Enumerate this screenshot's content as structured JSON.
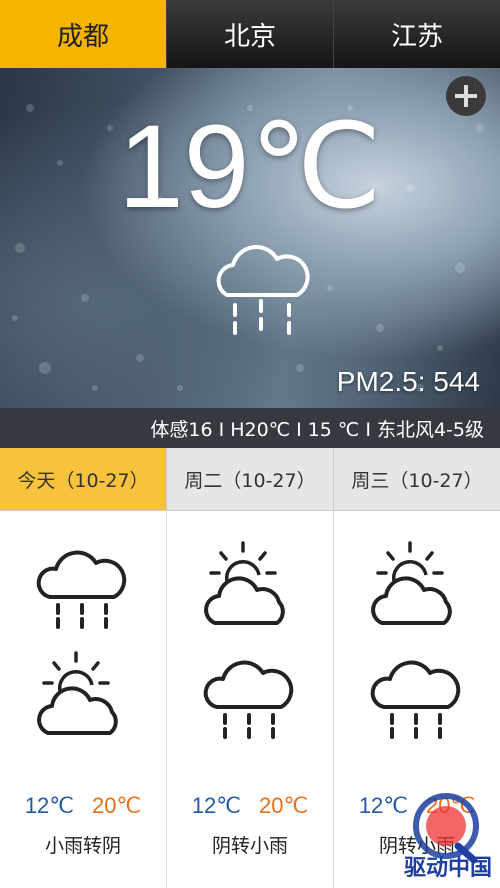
{
  "tabs": [
    "成都",
    "北京",
    "江苏"
  ],
  "current": {
    "temperature": "19℃",
    "pm25": "PM2.5: 544",
    "details": "体感16 I H20℃ I 15 ℃ I 东北风4-5级",
    "condition_icon": "rain-cloud-icon"
  },
  "days": [
    {
      "label": "今天（10-27）",
      "low": "12℃",
      "high": "20℃",
      "desc": "小雨转阴",
      "icon_day": "rain-cloud-icon",
      "icon_night": "sun-cloud-icon"
    },
    {
      "label": "周二（10-27）",
      "low": "12℃",
      "high": "20℃",
      "desc": "阴转小雨",
      "icon_day": "sun-cloud-icon",
      "icon_night": "rain-cloud-icon"
    },
    {
      "label": "周三（10-27）",
      "low": "12℃",
      "high": "20℃",
      "desc": "阴转小雨",
      "icon_day": "sun-cloud-icon",
      "icon_night": "rain-cloud-icon"
    }
  ],
  "watermark": "驱动中国",
  "colors": {
    "accent": "#f5b400",
    "low_temp": "#1f5aa8",
    "high_temp": "#e8701a"
  }
}
